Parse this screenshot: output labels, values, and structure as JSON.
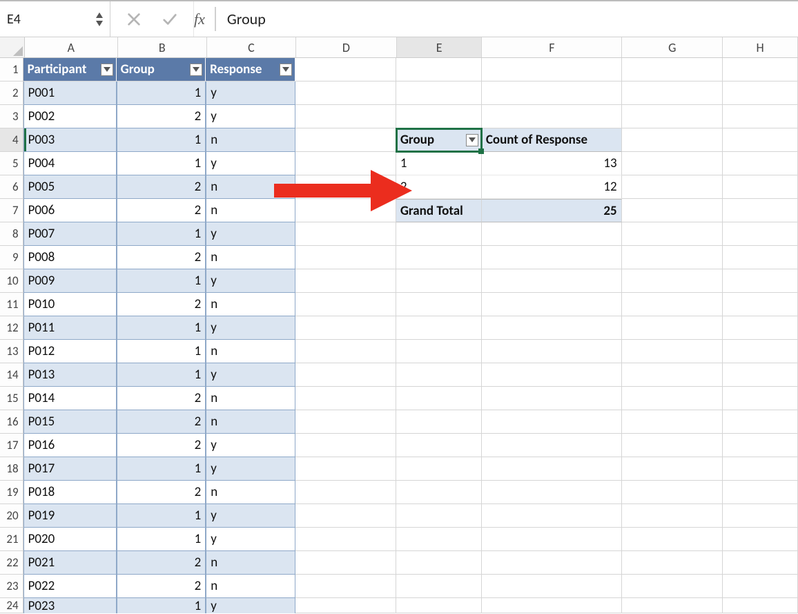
{
  "formula_bar": {
    "cell_ref": "E4",
    "fx_label": "fx",
    "value": "Group"
  },
  "columns": [
    "A",
    "B",
    "C",
    "D",
    "E",
    "F",
    "G",
    "H"
  ],
  "active_column": "E",
  "active_row": 4,
  "table": {
    "headers": [
      "Participant",
      "Group",
      "Response"
    ],
    "rows": [
      {
        "p": "P001",
        "g": 1,
        "r": "y"
      },
      {
        "p": "P002",
        "g": 2,
        "r": "y"
      },
      {
        "p": "P003",
        "g": 1,
        "r": "n"
      },
      {
        "p": "P004",
        "g": 1,
        "r": "y"
      },
      {
        "p": "P005",
        "g": 2,
        "r": "n"
      },
      {
        "p": "P006",
        "g": 2,
        "r": "n"
      },
      {
        "p": "P007",
        "g": 1,
        "r": "y"
      },
      {
        "p": "P008",
        "g": 2,
        "r": "n"
      },
      {
        "p": "P009",
        "g": 1,
        "r": "y"
      },
      {
        "p": "P010",
        "g": 2,
        "r": "n"
      },
      {
        "p": "P011",
        "g": 1,
        "r": "y"
      },
      {
        "p": "P012",
        "g": 1,
        "r": "n"
      },
      {
        "p": "P013",
        "g": 1,
        "r": "y"
      },
      {
        "p": "P014",
        "g": 2,
        "r": "n"
      },
      {
        "p": "P015",
        "g": 2,
        "r": "n"
      },
      {
        "p": "P016",
        "g": 2,
        "r": "y"
      },
      {
        "p": "P017",
        "g": 1,
        "r": "y"
      },
      {
        "p": "P018",
        "g": 2,
        "r": "n"
      },
      {
        "p": "P019",
        "g": 1,
        "r": "y"
      },
      {
        "p": "P020",
        "g": 1,
        "r": "y"
      },
      {
        "p": "P021",
        "g": 2,
        "r": "n"
      },
      {
        "p": "P022",
        "g": 2,
        "r": "n"
      },
      {
        "p": "P023",
        "g": 1,
        "r": "y"
      }
    ]
  },
  "pivot": {
    "header_group": "Group",
    "header_count": "Count of Response",
    "rows": [
      {
        "label": "1",
        "count": 13
      },
      {
        "label": "2",
        "count": 12
      }
    ],
    "total_label": "Grand Total",
    "total_value": 25
  },
  "icons": {
    "cancel": "cancel-icon",
    "enter": "enter-icon"
  }
}
